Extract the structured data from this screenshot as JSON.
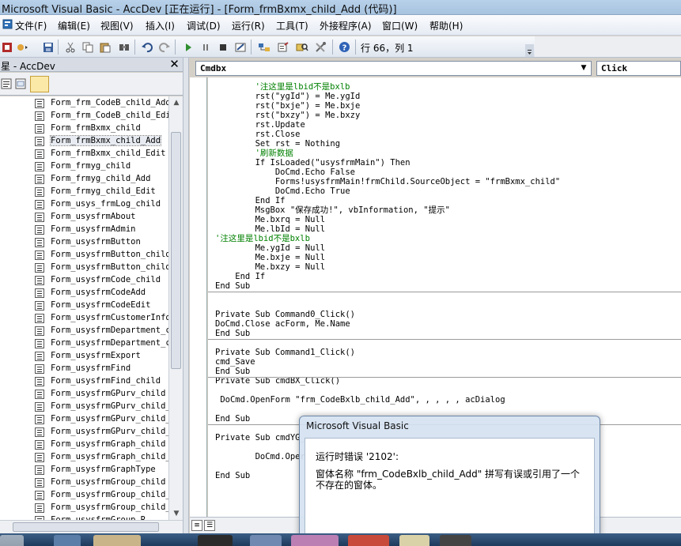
{
  "window": {
    "title": "Microsoft Visual Basic - AccDev [正在运行] - [Form_frmBxmx_child_Add (代码)]"
  },
  "menu": {
    "items": [
      "文件(F)",
      "编辑(E)",
      "视图(V)",
      "插入(I)",
      "调试(D)",
      "运行(R)",
      "工具(T)",
      "外接程序(A)",
      "窗口(W)",
      "帮助(H)"
    ]
  },
  "toolbar": {
    "position_text": "行 66，列 1"
  },
  "project": {
    "title": "星 - AccDev",
    "items": [
      "Form_frm_CodeB_child_Add",
      "Form_frm_CodeB_child_Edit",
      "Form_frmBxmx_child",
      "Form_frmBxmx_child_Add",
      "Form_frmBxmx_child_Edit",
      "Form_frmyg_child",
      "Form_frmyg_child_Add",
      "Form_frmyg_child_Edit",
      "Form_usys_frmLog_child",
      "Form_usysfrmAbout",
      "Form_usysfrmAdmin",
      "Form_usysfrmButton",
      "Form_usysfrmButton_child",
      "Form_usysfrmButton_child_",
      "Form_usysfrmCode_child",
      "Form_usysfrmCodeAdd",
      "Form_usysfrmCodeEdit",
      "Form_usysfrmCustomerInfor",
      "Form_usysfrmDepartment_ch",
      "Form_usysfrmDepartment_ch",
      "Form_usysfrmExport",
      "Form_usysfrmFind",
      "Form_usysfrmFind_child",
      "Form_usysfrmGPurv_child",
      "Form_usysfrmGPurv_child_A",
      "Form_usysfrmGPurv_child_E",
      "Form_usysfrmGPurv_child_I",
      "Form_usysfrmGraph_child",
      "Form_usysfrmGraph_child_",
      "Form_usysfrmGraphType",
      "Form_usysfrmGroup_child",
      "Form_usysfrmGroup_child_A",
      "Form_usysfrmGroup_child_I",
      "Form_usysfrmGroup_R..."
    ],
    "selected_index": 3
  },
  "code": {
    "object_combo": "Cmdbx",
    "proc_combo": "Click",
    "lines": [
      {
        "t": "        '注这里是lbid不是bxlb",
        "c": "cmt"
      },
      {
        "t": "        rst(\"ygId\") = Me.ygId",
        "c": "kw"
      },
      {
        "t": "        rst(\"bxje\") = Me.bxje",
        "c": "kw"
      },
      {
        "t": "        rst(\"bxzy\") = Me.bxzy",
        "c": "kw"
      },
      {
        "t": "        rst.Update",
        "c": "kw"
      },
      {
        "t": "        rst.Close",
        "c": "kw"
      },
      {
        "t": "        Set rst = Nothing",
        "c": "kw"
      },
      {
        "t": "        '刷新数据",
        "c": "cmt"
      },
      {
        "t": "        If IsLoaded(\"usysfrmMain\") Then",
        "c": "kw"
      },
      {
        "t": "            DoCmd.Echo False",
        "c": "kw"
      },
      {
        "t": "            Forms!usysfrmMain!frmChild.SourceObject = \"frmBxmx_child\"",
        "c": "kw"
      },
      {
        "t": "            DoCmd.Echo True",
        "c": "kw"
      },
      {
        "t": "        End If",
        "c": "kw"
      },
      {
        "t": "        MsgBox \"保存成功!\", vbInformation, \"提示\"",
        "c": "kw"
      },
      {
        "t": "        Me.bxrq = Null",
        "c": "kw"
      },
      {
        "t": "        Me.lbId = Null",
        "c": "kw"
      },
      {
        "t": "'注这里是lbid不是bxlb",
        "c": "cmt"
      },
      {
        "t": "        Me.ygId = Null",
        "c": "kw"
      },
      {
        "t": "        Me.bxje = Null",
        "c": "kw"
      },
      {
        "t": "        Me.bxzy = Null",
        "c": "kw"
      },
      {
        "t": "    End If",
        "c": "kw"
      },
      {
        "t": "End Sub",
        "c": "kw"
      },
      {
        "t": "",
        "c": "kw"
      },
      {
        "t": "",
        "c": "kw"
      },
      {
        "t": "Private Sub Command0_Click()",
        "c": "kw"
      },
      {
        "t": "DoCmd.Close acForm, Me.Name",
        "c": "kw"
      },
      {
        "t": "End Sub",
        "c": "kw"
      },
      {
        "t": "",
        "c": "kw"
      },
      {
        "t": "Private Sub Command1_Click()",
        "c": "kw"
      },
      {
        "t": "cmd_Save",
        "c": "kw"
      },
      {
        "t": "End Sub",
        "c": "kw"
      },
      {
        "t": "Private Sub cmdBX_Click()",
        "c": "kw"
      },
      {
        "t": "",
        "c": "kw"
      },
      {
        "t": " DoCmd.OpenForm \"frm_CodeBxlb_child_Add\", , , , , acDialog",
        "c": "kw"
      },
      {
        "t": "",
        "c": "kw"
      },
      {
        "t": "End Sub",
        "c": "kw"
      },
      {
        "t": "",
        "c": "kw"
      },
      {
        "t": "Private Sub cmdYG_",
        "c": "kw"
      },
      {
        "t": "",
        "c": "kw"
      },
      {
        "t": "        DoCmd.Oper",
        "c": "kw"
      },
      {
        "t": "",
        "c": "kw"
      },
      {
        "t": "End Sub",
        "c": "kw"
      }
    ]
  },
  "dialog": {
    "title": "Microsoft Visual Basic",
    "line1": "运行时错误 '2102':",
    "line2": "窗体名称 \"frm_CodeBxlb_child_Add\" 拼写有误或引用了一个不存在的窗体。"
  }
}
